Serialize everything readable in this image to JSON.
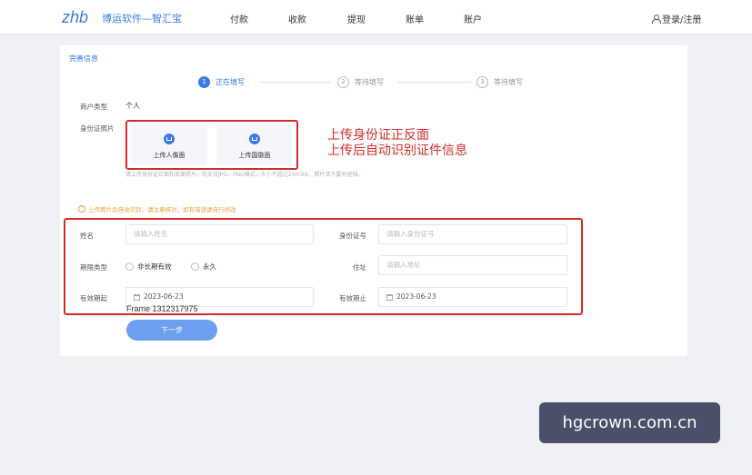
{
  "header": {
    "logo": "zhb",
    "brand": "博运软件—智汇宝",
    "nav": [
      "付款",
      "收款",
      "提现",
      "账单",
      "账户"
    ],
    "login": "登录/注册"
  },
  "card": {
    "title": "完善信息",
    "steps": [
      {
        "num": "1",
        "label": "正在填写"
      },
      {
        "num": "2",
        "label": "等待填写"
      },
      {
        "num": "3",
        "label": "等待填写"
      }
    ],
    "merchant_type_label": "商户类型",
    "merchant_type_value": "个人",
    "id_photo_label": "身份证照片",
    "upload_front": "上传人像面",
    "upload_back": "上传国徽面",
    "upload_hint": "请上传身份证正面和反面照片，仅支持JPG、PNG格式，大小不超过2000kb，照片请不要有遮挡。",
    "warning": "上传图片后自动识别，请注意核对，如有错误请自行修改",
    "name_label": "姓名",
    "name_placeholder": "请输入姓名",
    "idno_label": "身份证号",
    "idno_placeholder": "请输入身份证号",
    "validity_label": "期限类型",
    "radio_long": "非长期有效",
    "radio_forever": "永久",
    "address_label": "住址",
    "address_placeholder": "请输入地址",
    "start_label": "有效期起",
    "start_value": "2023-06-23",
    "end_label": "有效期止",
    "end_value": "2023-06-23",
    "frame_text": "Frame 1312317975",
    "next_button": "下一步"
  },
  "annotation": {
    "line1": "上传身份证正反面",
    "line2": "上传后自动识别证件信息",
    "color": "#d62b2b"
  },
  "watermark": "hgcrown.com.cn"
}
